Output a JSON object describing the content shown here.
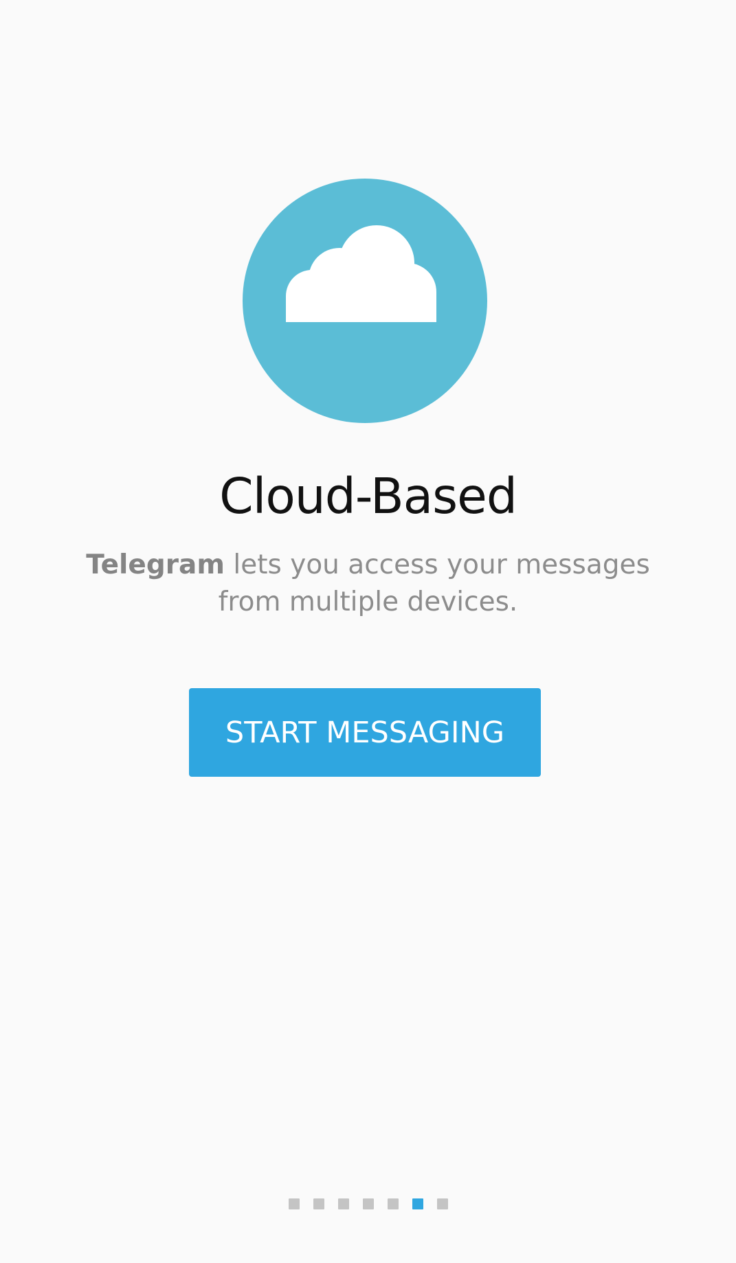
{
  "intro": {
    "title": "Cloud-Based",
    "description_brand": "Telegram",
    "description_rest": " lets you access your messages from multiple devices.",
    "start_button_label": "START MESSAGING"
  },
  "colors": {
    "background": "#fafafa",
    "hero_circle": "#5bbdd6",
    "accent": "#2fa6e0",
    "inactive_dot": "#c4c4c4"
  },
  "icons": {
    "hero": "cloud-icon"
  },
  "pager": {
    "total": 7,
    "active_index": 5
  }
}
